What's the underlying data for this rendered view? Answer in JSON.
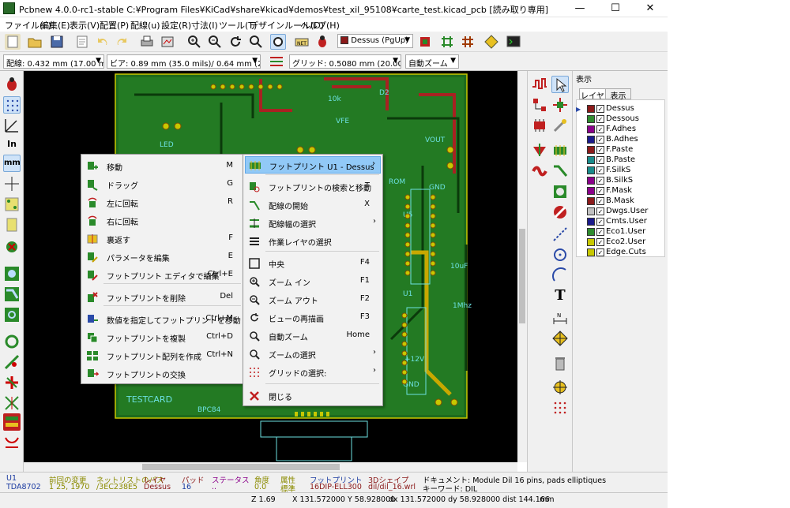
{
  "window": {
    "title": "Pcbnew 4.0.0-rc1-stable C:¥Program Files¥KiCad¥share¥kicad¥demos¥test_xil_95108¥carte_test.kicad_pcb [読み取り専用]",
    "minimize": "—",
    "maximize": "☐",
    "close": "✕"
  },
  "menubar": [
    "ファイル(F)",
    "編集(E)",
    "表示(V)",
    "配置(P)",
    "配線(u)",
    "設定(R)",
    "寸法(I)",
    "ツール(T)",
    "デザインルール(D)",
    "ヘルプ(H)"
  ],
  "toolbar": {
    "active_layer": "Dessus (PgUp)"
  },
  "toolbar2": {
    "track_width": "配線: 0.432 mm (17.00 mils) *",
    "via_size": "ビア: 0.89 mm (35.0 mils)/ 0.64 mm (25.0 mils) *",
    "grid": "グリッド: 0.5080 mm (20.00 mils)",
    "zoom": "自動ズーム"
  },
  "layers_panel": {
    "title": "表示",
    "tabs": [
      "レイヤ",
      "表示"
    ],
    "layers": [
      {
        "name": "Dessus",
        "color": "#8b1a1a",
        "checked": true,
        "active": true
      },
      {
        "name": "Dessous",
        "color": "#2e8b2e",
        "checked": true,
        "active": false
      },
      {
        "name": "F.Adhes",
        "color": "#8a008a",
        "checked": true,
        "active": false
      },
      {
        "name": "B.Adhes",
        "color": "#1a1a8b",
        "checked": true,
        "active": false
      },
      {
        "name": "F.Paste",
        "color": "#8b1a1a",
        "checked": true,
        "active": false
      },
      {
        "name": "B.Paste",
        "color": "#1a8b8b",
        "checked": true,
        "active": false
      },
      {
        "name": "F.SilkS",
        "color": "#1a8b8b",
        "checked": true,
        "active": false
      },
      {
        "name": "B.SilkS",
        "color": "#8a008a",
        "checked": true,
        "active": false
      },
      {
        "name": "F.Mask",
        "color": "#8a008a",
        "checked": true,
        "active": false
      },
      {
        "name": "B.Mask",
        "color": "#8b1a1a",
        "checked": true,
        "active": false
      },
      {
        "name": "Dwgs.User",
        "color": "#c0c0c0",
        "checked": true,
        "active": false
      },
      {
        "name": "Cmts.User",
        "color": "#1a1a8b",
        "checked": true,
        "active": false
      },
      {
        "name": "Eco1.User",
        "color": "#2e8b2e",
        "checked": true,
        "active": false
      },
      {
        "name": "Eco2.User",
        "color": "#c8c800",
        "checked": true,
        "active": false
      },
      {
        "name": "Edge.Cuts",
        "color": "#c8c800",
        "checked": true,
        "active": false
      }
    ]
  },
  "context_menu_left": [
    {
      "label": "移動",
      "accel": "M",
      "icon": "move-icon"
    },
    {
      "label": "ドラッグ",
      "accel": "G",
      "icon": "drag-icon"
    },
    {
      "label": "左に回転",
      "accel": "R",
      "icon": "rotate-ccw-icon"
    },
    {
      "label": "右に回転",
      "accel": "",
      "icon": "rotate-cw-icon"
    },
    {
      "label": "裏返す",
      "accel": "F",
      "icon": "flip-icon"
    },
    {
      "label": "パラメータを編集",
      "accel": "E",
      "icon": "edit-params-icon"
    },
    {
      "label": "フットプリント エディタで編集",
      "accel": "Ctrl+E",
      "icon": "module-editor-icon"
    },
    {
      "label": "フットプリントを削除",
      "accel": "Del",
      "icon": "delete-icon"
    },
    {
      "label": "数値を指定してフットプリントを移動",
      "accel": "Ctrl+M",
      "icon": "move-exact-icon"
    },
    {
      "label": "フットプリントを複製",
      "accel": "Ctrl+D",
      "icon": "duplicate-icon"
    },
    {
      "label": "フットプリント配列を作成",
      "accel": "Ctrl+N",
      "icon": "array-icon"
    },
    {
      "label": "フットプリントの交換",
      "accel": "",
      "icon": "exchange-icon"
    }
  ],
  "context_menu_right": [
    {
      "label": "フットプリント U1 - Dessus",
      "accel": "",
      "icon": "footprint-icon",
      "submenu": true
    },
    {
      "label": "フットプリントの検索と移動",
      "accel": "T",
      "icon": "find-move-icon",
      "submenu": false
    },
    {
      "label": "配線の開始",
      "accel": "X",
      "icon": "route-icon",
      "submenu": false
    },
    {
      "label": "配線幅の選択",
      "accel": "",
      "icon": "track-width-icon",
      "submenu": true
    },
    {
      "label": "作業レイヤの選択",
      "accel": "",
      "icon": "layer-select-icon",
      "submenu": false
    },
    {
      "label": "中央",
      "accel": "F4",
      "icon": "zoom-center-icon",
      "submenu": false
    },
    {
      "label": "ズーム イン",
      "accel": "F1",
      "icon": "zoom-in-icon",
      "submenu": false
    },
    {
      "label": "ズーム アウト",
      "accel": "F2",
      "icon": "zoom-out-icon",
      "submenu": false
    },
    {
      "label": "ビューの再描画",
      "accel": "F3",
      "icon": "redraw-icon",
      "submenu": false
    },
    {
      "label": "自動ズーム",
      "accel": "Home",
      "icon": "zoom-auto-icon",
      "submenu": false
    },
    {
      "label": "ズームの選択",
      "accel": "",
      "icon": "zoom-select-icon",
      "submenu": true
    },
    {
      "label": "グリッドの選択:",
      "accel": "",
      "icon": "grid-select-icon",
      "submenu": true
    },
    {
      "label": "閉じる",
      "accel": "",
      "icon": "close-menu-icon",
      "submenu": false
    }
  ],
  "msgpanel": [
    {
      "title": "U1",
      "value": "TDA8702",
      "color": "#1a3aa0",
      "vcolor": "#1a3aa0"
    },
    {
      "title": "前回の変更",
      "value": "1 25, 1970",
      "color": "#8b8b00",
      "vcolor": "#8b8b00"
    },
    {
      "title": "ネットリストのパス",
      "value": "/3EC238E5",
      "color": "#8b8b00",
      "vcolor": "#8b8b00"
    },
    {
      "title": "レイヤ",
      "value": "Dessus",
      "color": "#8b1a1a",
      "vcolor": "#8b1a1a"
    },
    {
      "title": "パッド",
      "value": "16",
      "color": "#8b1a1a",
      "vcolor": "#1a3aa0"
    },
    {
      "title": "ステータス",
      "value": "..",
      "color": "#8a008a",
      "vcolor": "#8a008a"
    },
    {
      "title": "角度",
      "value": "0.0",
      "color": "#8b8b00",
      "vcolor": "#8b8b00"
    },
    {
      "title": "属性",
      "value": "標準",
      "color": "#8b8b00",
      "vcolor": "#8b8b00"
    },
    {
      "title": "フットプリント",
      "value": "16DIP-ELL300",
      "color": "#1a3aa0",
      "vcolor": "#8b1a1a"
    },
    {
      "title": "3Dシェイプ",
      "value": "dil/dil_16.wrl",
      "color": "#8b1a1a",
      "vcolor": "#8b1a1a"
    }
  ],
  "msgpanel_doc": {
    "doc": "ドキュメント: Module Dil 16 pins, pads elliptiques",
    "keywords": "キーワード:  DIL"
  },
  "statusbar": {
    "z": "Z 1.69",
    "xy": "X 131.572000  Y 58.928000",
    "dxy": "dx 131.572000  dy 58.928000  dist 144.166",
    "units": "mm"
  },
  "board_labels": [
    "VOUT",
    "GND",
    "ROM",
    "U5",
    "U1",
    "10uF",
    "LED",
    "+12V",
    "GND",
    "1Mhz",
    "TESTCARD",
    "D2",
    "VFE",
    "10k",
    "BPC84"
  ]
}
